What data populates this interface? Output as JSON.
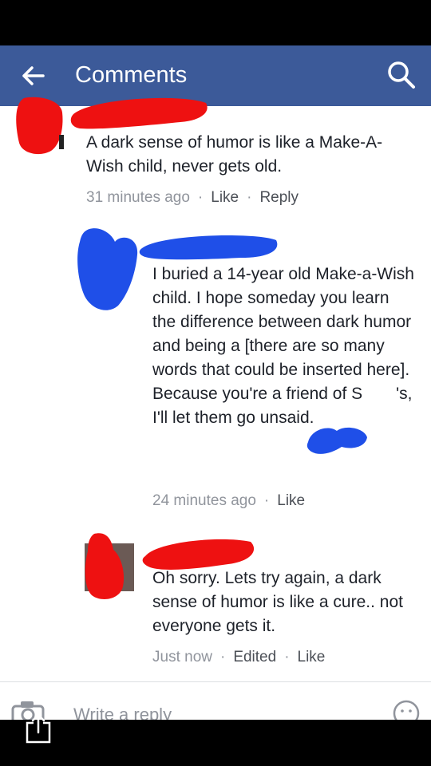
{
  "header": {
    "title": "Comments",
    "back_icon": "arrow-left-icon",
    "search_icon": "search-icon"
  },
  "comments": [
    {
      "text": "A dark sense of humor is like a Make-A-Wish child, never gets old.",
      "time": "31 minutes ago",
      "like": "Like",
      "reply": "Reply",
      "redaction_color": "#ee1111"
    },
    {
      "text_before": "I buried a 14-year old Make-a-Wish child. I hope someday you learn the difference between dark humor and being a [there are so many words that could be inserted here]. Because you're a friend of S",
      "text_after": "'s, I'll let them go unsaid.",
      "time": "24 minutes ago",
      "like": "Like",
      "redaction_color": "#1f4fe8"
    },
    {
      "text": "Oh sorry. Lets try again, a dark sense of humor is like a cure.. not everyone gets it.",
      "time": "Just now",
      "edited": "Edited",
      "like": "Like",
      "redaction_color": "#ee1111"
    }
  ],
  "composer": {
    "placeholder": "Write a reply",
    "camera_icon": "camera-icon",
    "emoji_icon": "emoji-icon"
  },
  "system": {
    "share_icon": "share-icon"
  }
}
